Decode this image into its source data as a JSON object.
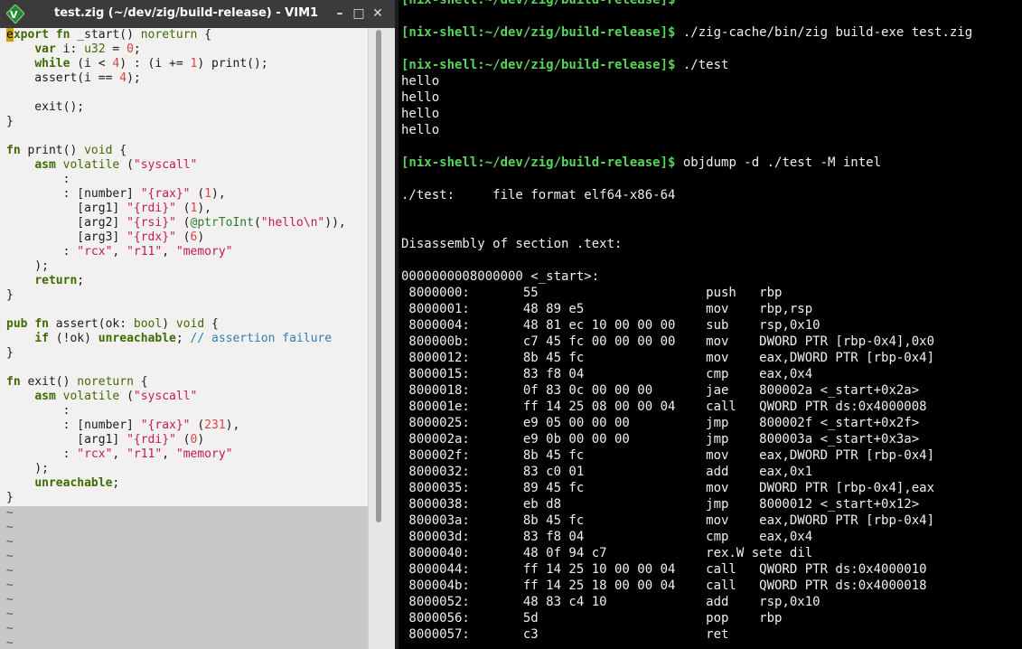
{
  "vim": {
    "title": "test.zig (~/dev/zig/build-release) - VIM1",
    "buttons": {
      "minimize": "–",
      "maximize": "□",
      "close": "✕"
    },
    "code": [
      [
        {
          "t": "e",
          "c": "cursor"
        },
        {
          "t": "xport",
          "c": "kw"
        },
        {
          "t": " "
        },
        {
          "t": "fn",
          "c": "kw"
        },
        {
          "t": " _start() "
        },
        {
          "t": "noreturn",
          "c": "ty"
        },
        {
          "t": " {"
        }
      ],
      [
        {
          "t": "    "
        },
        {
          "t": "var",
          "c": "kw"
        },
        {
          "t": " i: "
        },
        {
          "t": "u32",
          "c": "ty"
        },
        {
          "t": " = "
        },
        {
          "t": "0",
          "c": "st2"
        },
        {
          "t": ";"
        }
      ],
      [
        {
          "t": "    "
        },
        {
          "t": "while",
          "c": "kw"
        },
        {
          "t": " (i < "
        },
        {
          "t": "4",
          "c": "st2"
        },
        {
          "t": ") : (i += "
        },
        {
          "t": "1",
          "c": "st2"
        },
        {
          "t": ") print();"
        }
      ],
      [
        {
          "t": "    assert(i == "
        },
        {
          "t": "4",
          "c": "st2"
        },
        {
          "t": ");"
        }
      ],
      [
        {
          "t": ""
        }
      ],
      [
        {
          "t": "    exit();"
        }
      ],
      [
        {
          "t": "}"
        }
      ],
      [
        {
          "t": ""
        }
      ],
      [
        {
          "t": "fn",
          "c": "kw"
        },
        {
          "t": " print() "
        },
        {
          "t": "void",
          "c": "ty"
        },
        {
          "t": " {"
        }
      ],
      [
        {
          "t": "    "
        },
        {
          "t": "asm",
          "c": "kw"
        },
        {
          "t": " "
        },
        {
          "t": "volatile",
          "c": "ty"
        },
        {
          "t": " ("
        },
        {
          "t": "\"syscall\"",
          "c": "st"
        }
      ],
      [
        {
          "t": "        :"
        }
      ],
      [
        {
          "t": "        : [number] "
        },
        {
          "t": "\"{rax}\"",
          "c": "st"
        },
        {
          "t": " ("
        },
        {
          "t": "1",
          "c": "st2"
        },
        {
          "t": "),"
        }
      ],
      [
        {
          "t": "          [arg1] "
        },
        {
          "t": "\"{rdi}\"",
          "c": "st"
        },
        {
          "t": " ("
        },
        {
          "t": "1",
          "c": "st2"
        },
        {
          "t": "),"
        }
      ],
      [
        {
          "t": "          [arg2] "
        },
        {
          "t": "\"{rsi}\"",
          "c": "st"
        },
        {
          "t": " ("
        },
        {
          "t": "@ptrToInt",
          "c": "bi"
        },
        {
          "t": "("
        },
        {
          "t": "\"hello\\n\"",
          "c": "st"
        },
        {
          "t": ")),"
        }
      ],
      [
        {
          "t": "          [arg3] "
        },
        {
          "t": "\"{rdx}\"",
          "c": "st"
        },
        {
          "t": " ("
        },
        {
          "t": "6",
          "c": "st2"
        },
        {
          "t": ")"
        }
      ],
      [
        {
          "t": "        : "
        },
        {
          "t": "\"rcx\"",
          "c": "st"
        },
        {
          "t": ", "
        },
        {
          "t": "\"r11\"",
          "c": "st"
        },
        {
          "t": ", "
        },
        {
          "t": "\"memory\"",
          "c": "st"
        }
      ],
      [
        {
          "t": "    );"
        }
      ],
      [
        {
          "t": "    "
        },
        {
          "t": "return",
          "c": "kw"
        },
        {
          "t": ";"
        }
      ],
      [
        {
          "t": "}"
        }
      ],
      [
        {
          "t": ""
        }
      ],
      [
        {
          "t": "pub",
          "c": "kw"
        },
        {
          "t": " "
        },
        {
          "t": "fn",
          "c": "kw"
        },
        {
          "t": " assert(ok: "
        },
        {
          "t": "bool",
          "c": "ty"
        },
        {
          "t": ") "
        },
        {
          "t": "void",
          "c": "ty"
        },
        {
          "t": " {"
        }
      ],
      [
        {
          "t": "    "
        },
        {
          "t": "if",
          "c": "kw"
        },
        {
          "t": " (!ok) "
        },
        {
          "t": "unreachable",
          "c": "kw"
        },
        {
          "t": "; "
        },
        {
          "t": "// assertion failure",
          "c": "cm"
        }
      ],
      [
        {
          "t": "}"
        }
      ],
      [
        {
          "t": ""
        }
      ],
      [
        {
          "t": "fn",
          "c": "kw"
        },
        {
          "t": " exit() "
        },
        {
          "t": "noreturn",
          "c": "ty"
        },
        {
          "t": " {"
        }
      ],
      [
        {
          "t": "    "
        },
        {
          "t": "asm",
          "c": "kw"
        },
        {
          "t": " "
        },
        {
          "t": "volatile",
          "c": "ty"
        },
        {
          "t": " ("
        },
        {
          "t": "\"syscall\"",
          "c": "st"
        }
      ],
      [
        {
          "t": "        :"
        }
      ],
      [
        {
          "t": "        : [number] "
        },
        {
          "t": "\"{rax}\"",
          "c": "st"
        },
        {
          "t": " ("
        },
        {
          "t": "231",
          "c": "st2"
        },
        {
          "t": "),"
        }
      ],
      [
        {
          "t": "          [arg1] "
        },
        {
          "t": "\"{rdi}\"",
          "c": "st"
        },
        {
          "t": " ("
        },
        {
          "t": "0",
          "c": "st2"
        },
        {
          "t": ")"
        }
      ],
      [
        {
          "t": "        : "
        },
        {
          "t": "\"rcx\"",
          "c": "st"
        },
        {
          "t": ", "
        },
        {
          "t": "\"r11\"",
          "c": "st"
        },
        {
          "t": ", "
        },
        {
          "t": "\"memory\"",
          "c": "st"
        }
      ],
      [
        {
          "t": "    );"
        }
      ],
      [
        {
          "t": "    "
        },
        {
          "t": "unreachable",
          "c": "kw"
        },
        {
          "t": ";"
        }
      ],
      [
        {
          "t": "}"
        }
      ]
    ],
    "tilde": "~",
    "tilde_count": 10
  },
  "terminal": {
    "lines": [
      {
        "prompt": "[nix-shell:~/dev/zig/build-release]$",
        "cmd": ""
      },
      {
        "text": ""
      },
      {
        "prompt": "[nix-shell:~/dev/zig/build-release]$",
        "cmd": " ./zig-cache/bin/zig build-exe test.zig"
      },
      {
        "text": ""
      },
      {
        "prompt": "[nix-shell:~/dev/zig/build-release]$",
        "cmd": " ./test"
      },
      {
        "text": "hello"
      },
      {
        "text": "hello"
      },
      {
        "text": "hello"
      },
      {
        "text": "hello"
      },
      {
        "text": ""
      },
      {
        "prompt": "[nix-shell:~/dev/zig/build-release]$",
        "cmd": " objdump -d ./test -M intel"
      },
      {
        "text": ""
      },
      {
        "text": "./test:     file format elf64-x86-64"
      },
      {
        "text": ""
      },
      {
        "text": ""
      },
      {
        "text": "Disassembly of section .text:"
      },
      {
        "text": ""
      },
      {
        "text": "0000000008000000 <_start>:"
      },
      {
        "text": " 8000000:\t55                   \tpush   rbp"
      },
      {
        "text": " 8000001:\t48 89 e5             \tmov    rbp,rsp"
      },
      {
        "text": " 8000004:\t48 81 ec 10 00 00 00 \tsub    rsp,0x10"
      },
      {
        "text": " 800000b:\tc7 45 fc 00 00 00 00 \tmov    DWORD PTR [rbp-0x4],0x0"
      },
      {
        "text": " 8000012:\t8b 45 fc             \tmov    eax,DWORD PTR [rbp-0x4]"
      },
      {
        "text": " 8000015:\t83 f8 04             \tcmp    eax,0x4"
      },
      {
        "text": " 8000018:\t0f 83 0c 00 00 00    \tjae    800002a <_start+0x2a>"
      },
      {
        "text": " 800001e:\tff 14 25 08 00 00 04 \tcall   QWORD PTR ds:0x4000008"
      },
      {
        "text": " 8000025:\te9 05 00 00 00       \tjmp    800002f <_start+0x2f>"
      },
      {
        "text": " 800002a:\te9 0b 00 00 00       \tjmp    800003a <_start+0x3a>"
      },
      {
        "text": " 800002f:\t8b 45 fc             \tmov    eax,DWORD PTR [rbp-0x4]"
      },
      {
        "text": " 8000032:\t83 c0 01             \tadd    eax,0x1"
      },
      {
        "text": " 8000035:\t89 45 fc             \tmov    DWORD PTR [rbp-0x4],eax"
      },
      {
        "text": " 8000038:\teb d8                \tjmp    8000012 <_start+0x12>"
      },
      {
        "text": " 800003a:\t8b 45 fc             \tmov    eax,DWORD PTR [rbp-0x4]"
      },
      {
        "text": " 800003d:\t83 f8 04             \tcmp    eax,0x4"
      },
      {
        "text": " 8000040:\t48 0f 94 c7          \trex.W sete dil"
      },
      {
        "text": " 8000044:\tff 14 25 10 00 00 04 \tcall   QWORD PTR ds:0x4000010"
      },
      {
        "text": " 800004b:\tff 14 25 18 00 00 04 \tcall   QWORD PTR ds:0x4000018"
      },
      {
        "text": " 8000052:\t48 83 c4 10          \tadd    rsp,0x10"
      },
      {
        "text": " 8000056:\t5d                   \tpop    rbp"
      },
      {
        "text": " 8000057:\tc3                   \tret"
      }
    ]
  }
}
